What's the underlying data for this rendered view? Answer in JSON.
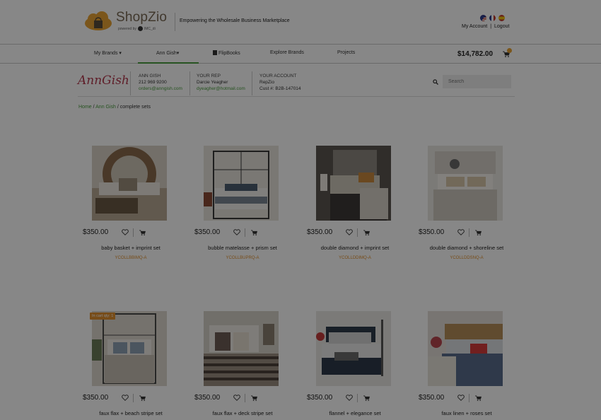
{
  "header": {
    "logo_text": "ShopZio",
    "logo_powered": "powered by",
    "logo_imc": "IMC_di",
    "tagline": "Empowering the Wholesale Business Marketplace",
    "my_account": "My Account",
    "separator": "|",
    "logout": "Logout"
  },
  "nav": {
    "my_brands": "My Brands ▾",
    "ann_gish": "Ann Gish▾",
    "flipbooks": "FlipBooks",
    "explore_brands": "Explore Brands",
    "projects": "Projects",
    "cart_total": "$14,782.00",
    "cart_count": "8"
  },
  "brand": {
    "logo": "AnnGish",
    "company_heading": "ANN GISH",
    "company_phone": "212 969 9200",
    "company_email": "orders@anngish.com",
    "rep_heading": "YOUR REP",
    "rep_name": "Darcie Yeagher",
    "rep_email": "dyeagher@hotmail.com",
    "account_heading": "YOUR ACCOUNT",
    "account_name": "RepZio",
    "account_cust": "Cust #: B2B-147014",
    "search_placeholder": "Search"
  },
  "breadcrumb": {
    "home": "Home",
    "sep1": " / ",
    "brand": "Ann Gish",
    "sep2": " / ",
    "current": "complete sets"
  },
  "products": [
    {
      "price": "$350.00",
      "name": "baby basket + imprint set",
      "sku": "YCOLLBBIMQ-A"
    },
    {
      "price": "$350.00",
      "name": "bubble matelasse + prism set",
      "sku": "YCOLLBUPRQ-A"
    },
    {
      "price": "$350.00",
      "name": "double diamond + imprint set",
      "sku": "YCOLLDDIMQ-A"
    },
    {
      "price": "$350.00",
      "name": "double diamond + shoreline set",
      "sku": "YCOLLDDSNQ-A"
    },
    {
      "price": "$350.00",
      "name": "faux flax + beach stripe set",
      "sku": ""
    },
    {
      "price": "$350.00",
      "name": "faux flax + deck stripe set",
      "sku": ""
    },
    {
      "price": "$350.00",
      "name": "flannel + elegance set",
      "sku": ""
    },
    {
      "price": "$350.00",
      "name": "faux linen + roses set",
      "sku": ""
    }
  ],
  "in_cart_badge": "In cart qty: 1",
  "colors": {
    "accent_green": "#4a9e3f",
    "sku_orange": "#e0902f",
    "overlay": "rgba(0,0,0,0.47)"
  }
}
